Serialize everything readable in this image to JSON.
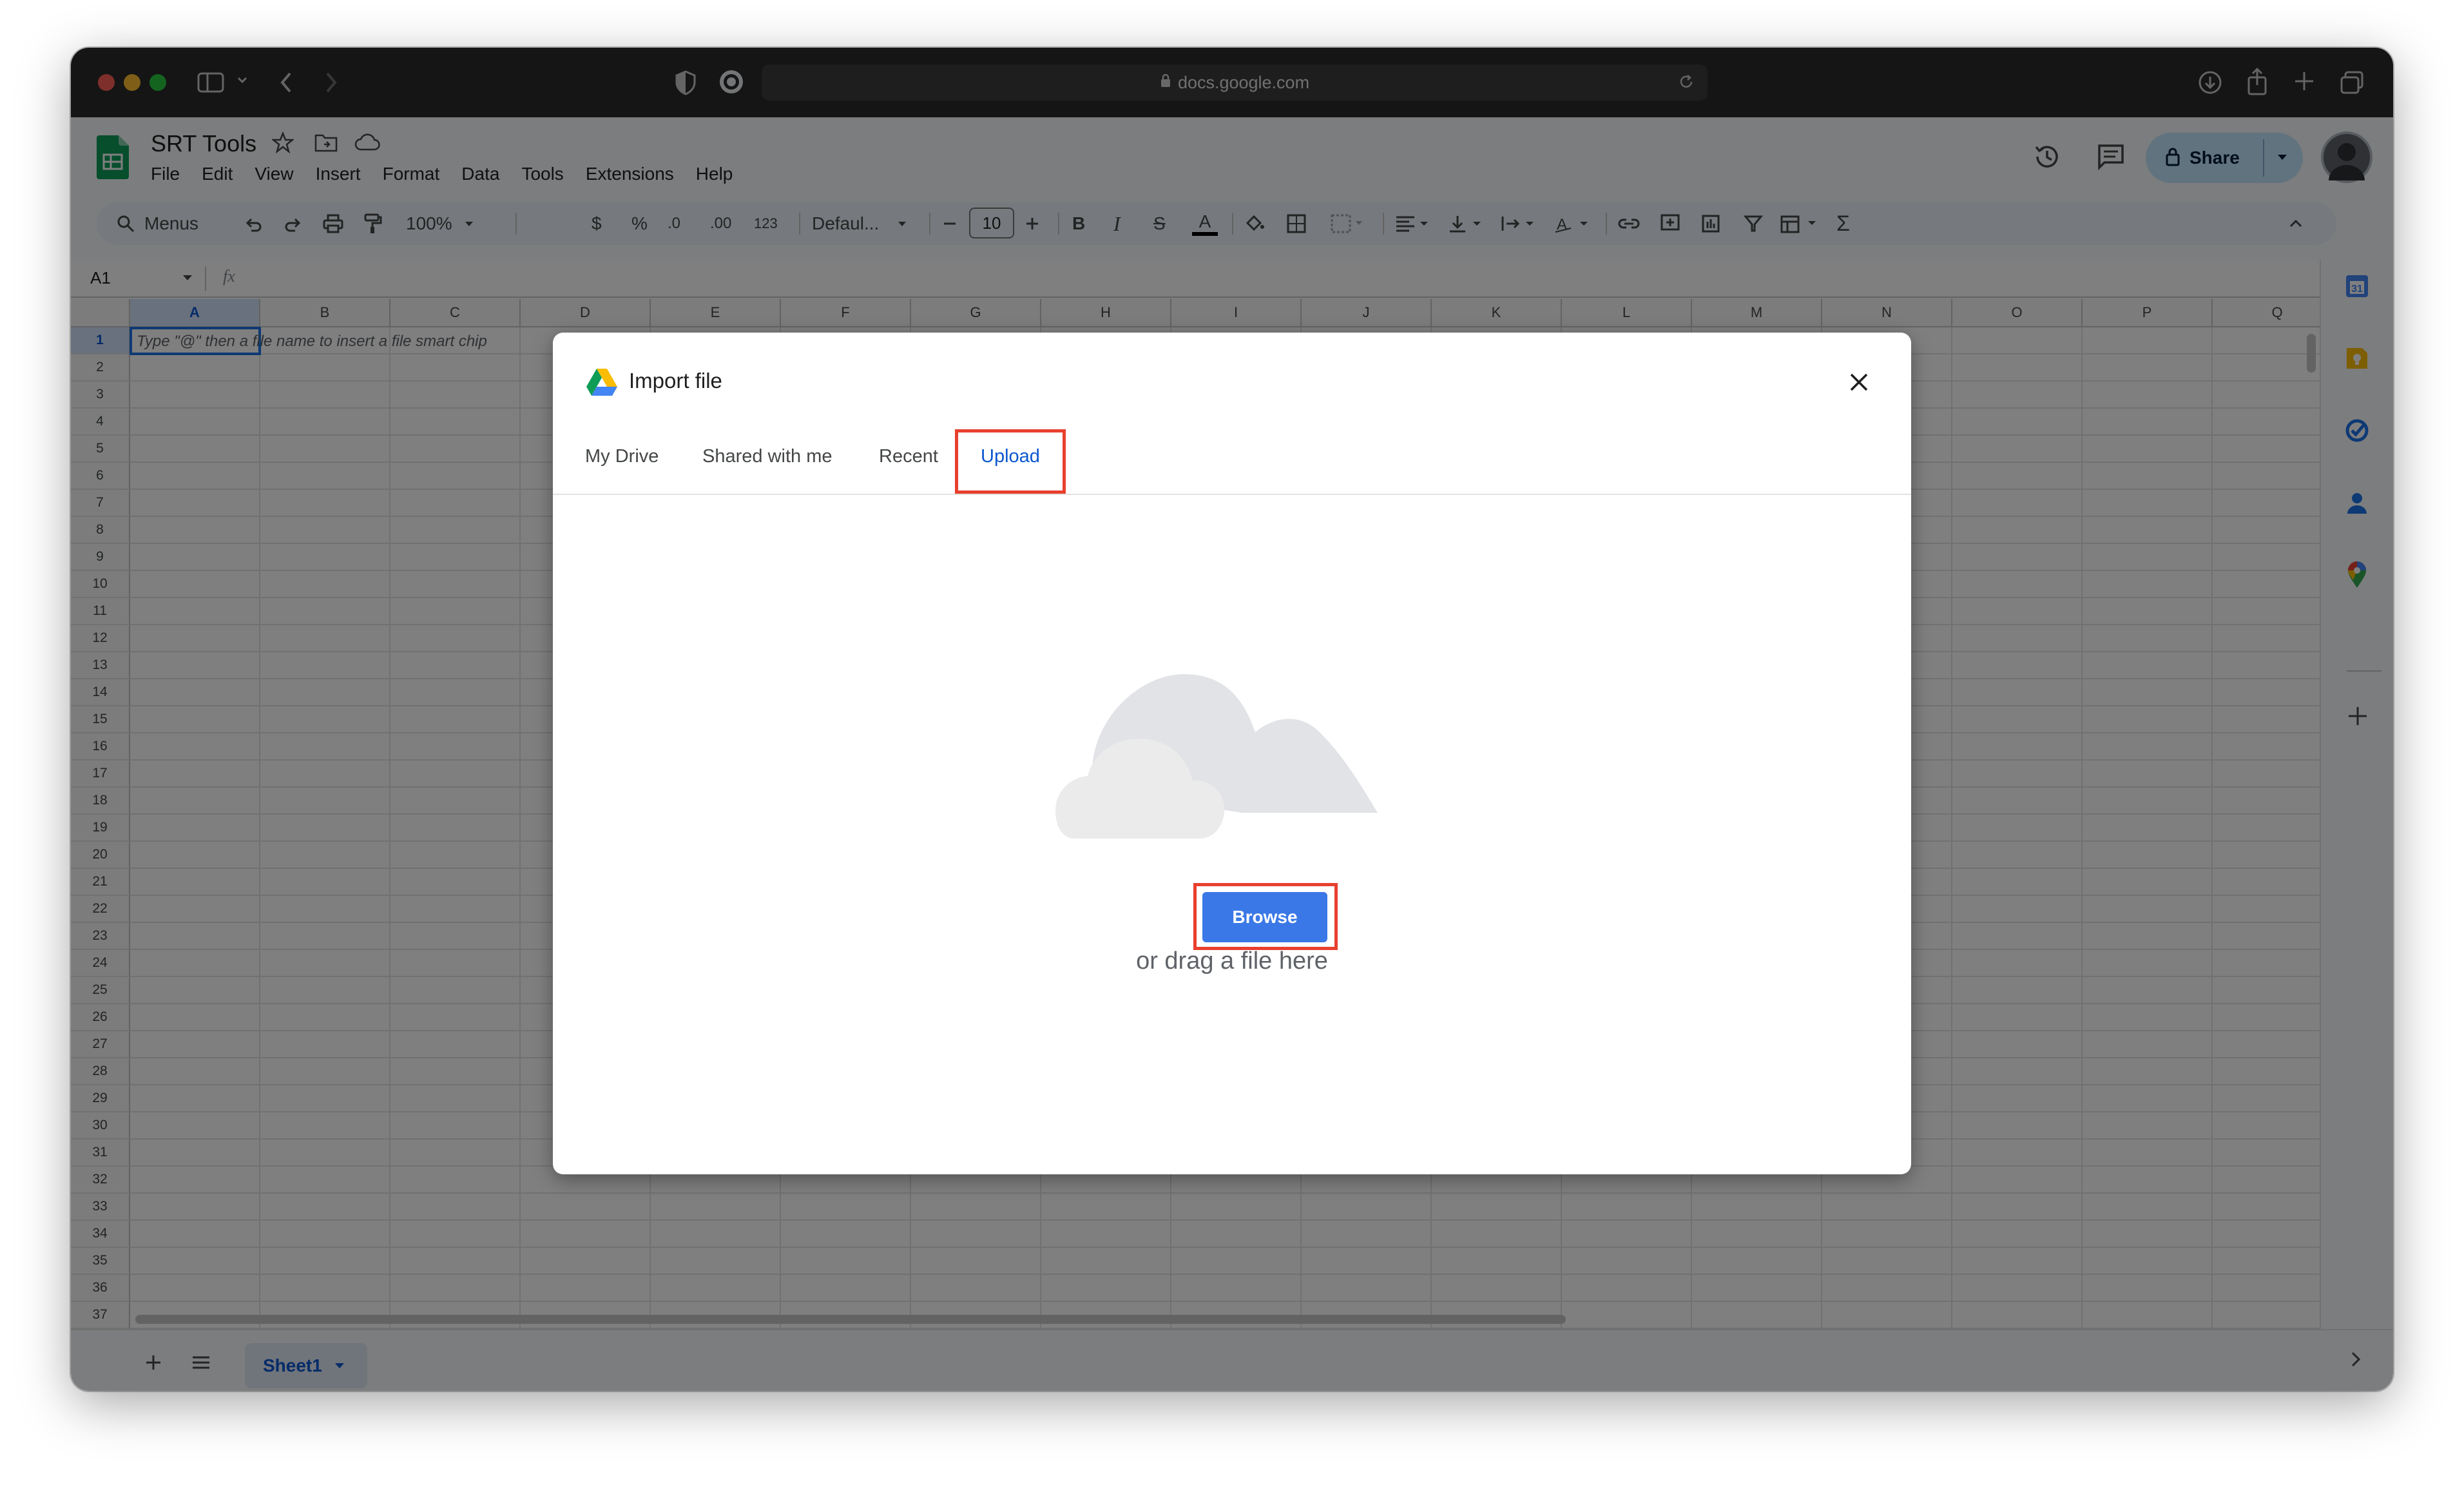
{
  "browser": {
    "url": "docs.google.com"
  },
  "doc": {
    "title": "SRT Tools",
    "menu": [
      "File",
      "Edit",
      "View",
      "Insert",
      "Format",
      "Data",
      "Tools",
      "Extensions",
      "Help"
    ],
    "share_label": "Share"
  },
  "toolbar": {
    "menus_label": "Menus",
    "zoom": "100%",
    "currency": "$",
    "percent": "%",
    "dec_decrease": ".0",
    "dec_increase": ".00",
    "number_format": "123",
    "font": "Defaul...",
    "font_size": "10",
    "bold": "B",
    "italic": "I",
    "strike": "S",
    "text_color": "A",
    "sum": "Σ"
  },
  "formula_bar": {
    "cell_ref": "A1",
    "fx": "fx"
  },
  "sheet": {
    "columns": [
      "A",
      "B",
      "C",
      "D",
      "E",
      "F",
      "G",
      "H",
      "I",
      "J",
      "K",
      "L",
      "M",
      "N",
      "O",
      "P",
      "Q"
    ],
    "rows": [
      "1",
      "2",
      "3",
      "4",
      "5",
      "6",
      "7",
      "8",
      "9",
      "10",
      "11",
      "12",
      "13",
      "14",
      "15",
      "16",
      "17",
      "18",
      "19",
      "20",
      "21",
      "22",
      "23",
      "24",
      "25",
      "26",
      "27",
      "28",
      "29",
      "30",
      "31",
      "32",
      "33",
      "34",
      "35",
      "36",
      "37"
    ],
    "a1_hint": "Type \"@\" then a file name to insert a file smart chip",
    "tab_name": "Sheet1"
  },
  "dialog": {
    "title": "Import file",
    "tabs": [
      "My Drive",
      "Shared with me",
      "Recent",
      "Upload"
    ],
    "active_tab": "Upload",
    "browse_label": "Browse",
    "drag_hint": "or drag a file here"
  },
  "colors": {
    "accent_blue": "#3b78e7",
    "active_tab_text": "#0b57d0",
    "highlight_red": "#e8402e",
    "sheets_green": "#0f9d58"
  }
}
